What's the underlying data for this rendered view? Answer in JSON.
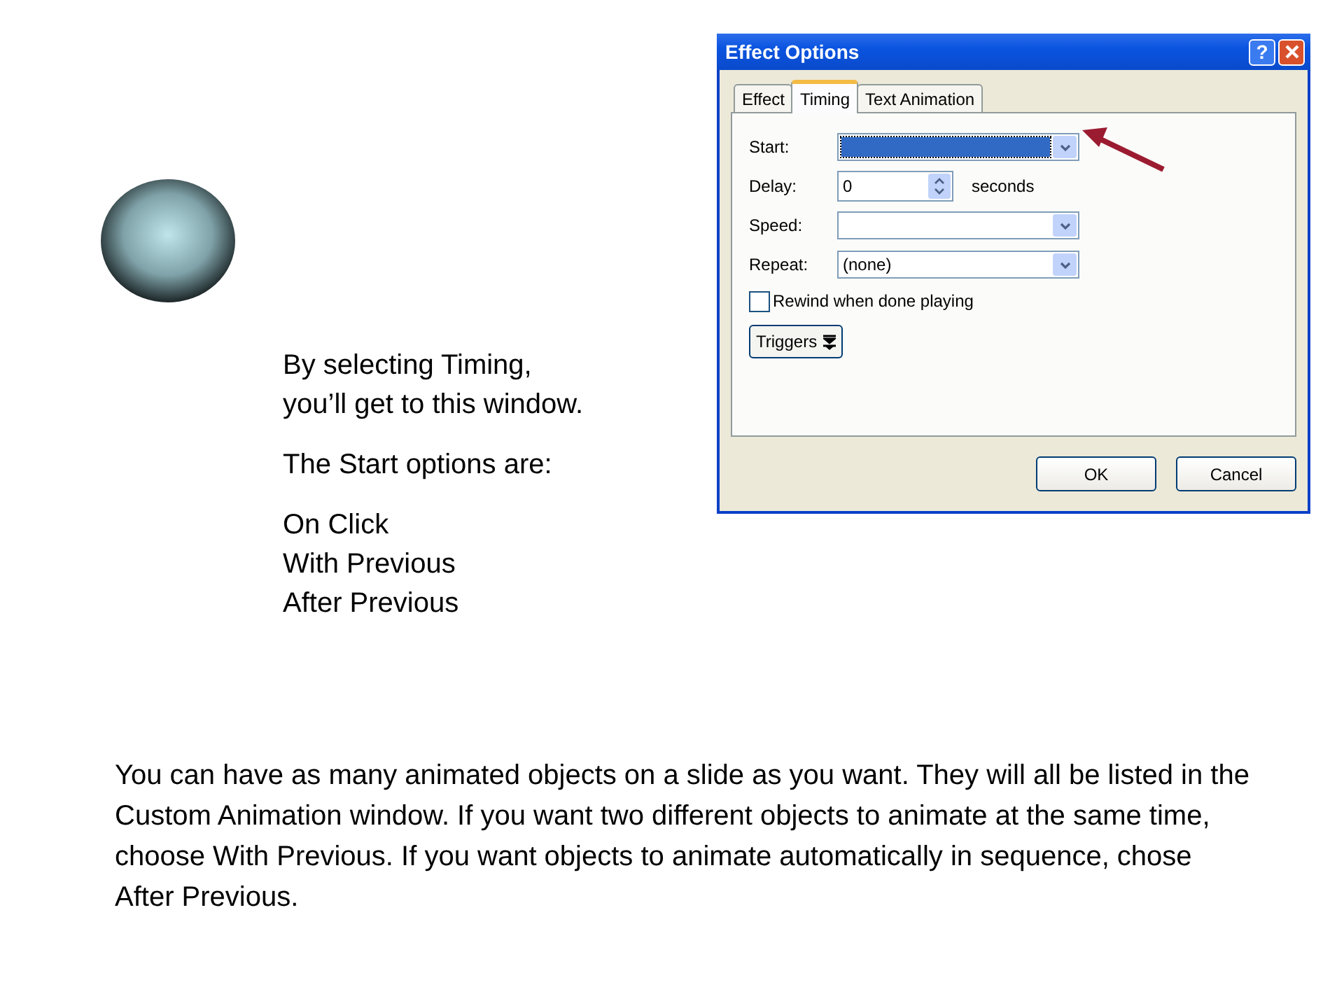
{
  "dialog": {
    "title": "Effect Options",
    "help_button": "?",
    "tabs": [
      {
        "label": "Effect",
        "selected": false
      },
      {
        "label": "Timing",
        "selected": true
      },
      {
        "label": "Text Animation",
        "selected": false
      }
    ],
    "fields": [
      {
        "kind": "dropdown",
        "label": "Start:",
        "focused": true
      },
      {
        "kind": "spinner",
        "label": "Delay:",
        "value": "0",
        "unit": "seconds",
        "focused": false
      },
      {
        "kind": "dropdown",
        "label": "Speed:",
        "focused": false
      },
      {
        "kind": "dropdown",
        "label": "Repeat:",
        "value": "(none)",
        "focused": false
      }
    ],
    "checkbox": {
      "label": "Rewind when done playing",
      "checked": false
    },
    "triggers_button": "Triggers",
    "buttons": [
      "OK",
      "Cancel"
    ]
  },
  "caption_lines": [
    "By selecting Timing,",
    "you’ll get to this window."
  ],
  "options_heading": "The Start options are:",
  "start_options": [
    "On Click",
    "With Previous",
    "After Previous"
  ],
  "body_text": "You can have as many animated objects on a slide as you want. They will all be listed in the Custom Animation window. If you want two different objects to animate at the same time, choose With Previous. If you want objects to animate automatically in sequence, chose After Previous."
}
